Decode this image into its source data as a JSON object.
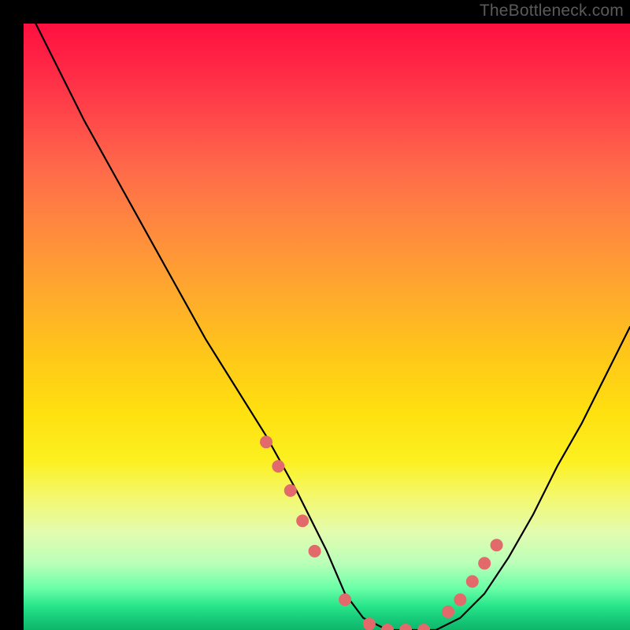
{
  "attribution": "TheBottleneck.com",
  "chart_data": {
    "type": "line",
    "title": "",
    "xlabel": "",
    "ylabel": "",
    "xlim": [
      0,
      100
    ],
    "ylim": [
      0,
      100
    ],
    "curve": {
      "name": "bottleneck-curve",
      "x": [
        2,
        5,
        10,
        15,
        20,
        25,
        30,
        35,
        40,
        45,
        50,
        53,
        56,
        60,
        64,
        68,
        72,
        76,
        80,
        84,
        88,
        92,
        96,
        100
      ],
      "y_loss": [
        100,
        94,
        84,
        75,
        66,
        57,
        48,
        40,
        32,
        23,
        13,
        6,
        2,
        0,
        0,
        0,
        2,
        6,
        12,
        19,
        27,
        34,
        42,
        50
      ]
    },
    "markers": {
      "name": "highlighted-points",
      "x": [
        40,
        42,
        44,
        46,
        48,
        53,
        57,
        60,
        63,
        66,
        70,
        72,
        74,
        76,
        78
      ],
      "y_loss": [
        31,
        27,
        23,
        18,
        13,
        5,
        1,
        0,
        0,
        0,
        3,
        5,
        8,
        11,
        14
      ],
      "color": "#e36a6a",
      "radius": 8
    },
    "gradient_stops": [
      {
        "pos": 0,
        "color": "#ff1040"
      },
      {
        "pos": 34,
        "color": "#ff8a3e"
      },
      {
        "pos": 64,
        "color": "#ffe010"
      },
      {
        "pos": 89,
        "color": "#baffb8"
      },
      {
        "pos": 100,
        "color": "#0eb66a"
      }
    ]
  }
}
